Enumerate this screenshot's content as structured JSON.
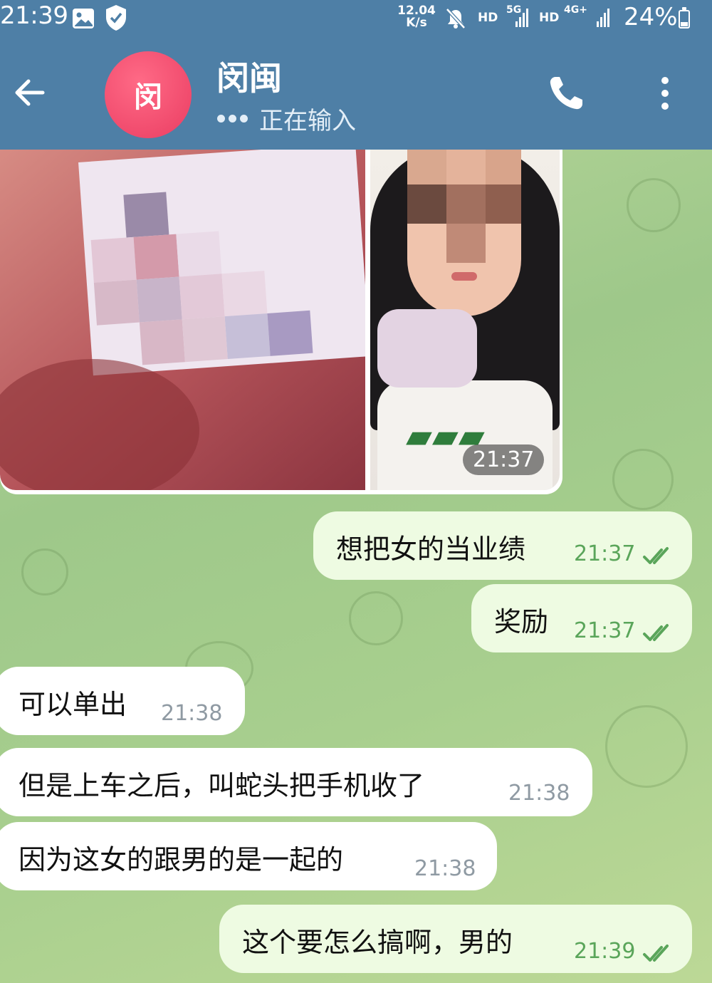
{
  "status_bar": {
    "time": "21:39",
    "net_speed_value": "12.04",
    "net_speed_unit": "K/s",
    "hd1": "HD",
    "sig_5g": "5G",
    "hd2": "HD",
    "sig_4g": "4G+",
    "battery": "24%",
    "icons": [
      "gallery-icon",
      "shield-check-icon",
      "mute-icon",
      "signal-icon",
      "battery-icon"
    ]
  },
  "header": {
    "avatar_initial": "闵",
    "contact_name": "闵闽",
    "status": "正在输入",
    "icons": [
      "back-arrow-icon",
      "phone-icon",
      "more-vert-icon"
    ]
  },
  "album": {
    "time": "21:37"
  },
  "messages": [
    {
      "direction": "out",
      "text": "想把女的当业绩",
      "time": "21:37",
      "read": true
    },
    {
      "direction": "out",
      "text": "奖励",
      "time": "21:37",
      "read": true
    },
    {
      "direction": "in",
      "text": "可以单出",
      "time": "21:38"
    },
    {
      "direction": "in",
      "text": "但是上车之后，叫蛇头把手机收了",
      "time": "21:38"
    },
    {
      "direction": "in",
      "text": "因为这女的跟男的是一起的",
      "time": "21:38"
    },
    {
      "direction": "out",
      "text": "这个要怎么搞啊，男的",
      "time": "21:39",
      "read": true
    }
  ],
  "colors": {
    "header_bg": "#4e7fa6",
    "avatar": "#ea3d62",
    "outgoing_bubble": "#eefbe2",
    "incoming_bubble": "#ffffff",
    "check_green": "#5aa55a"
  }
}
